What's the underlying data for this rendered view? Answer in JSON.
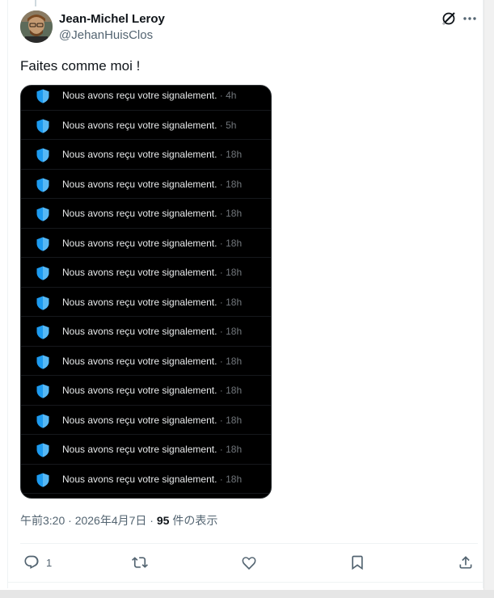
{
  "tweet": {
    "author": {
      "display_name": "Jean-Michel Leroy",
      "handle": "@JehanHuisClos"
    },
    "text": "Faites comme moi !",
    "icons": {
      "grok": "grok-icon",
      "more": "more-icon"
    },
    "media": {
      "notifications": [
        {
          "text": "Nous avons reçu votre signalement.",
          "time": " · 4h"
        },
        {
          "text": "Nous avons reçu votre signalement.",
          "time": " · 5h"
        },
        {
          "text": "Nous avons reçu votre signalement.",
          "time": " · 18h"
        },
        {
          "text": "Nous avons reçu votre signalement.",
          "time": " · 18h"
        },
        {
          "text": "Nous avons reçu votre signalement.",
          "time": " · 18h"
        },
        {
          "text": "Nous avons reçu votre signalement.",
          "time": " · 18h"
        },
        {
          "text": "Nous avons reçu votre signalement.",
          "time": " · 18h"
        },
        {
          "text": "Nous avons reçu votre signalement.",
          "time": " · 18h"
        },
        {
          "text": "Nous avons reçu votre signalement.",
          "time": " · 18h"
        },
        {
          "text": "Nous avons reçu votre signalement.",
          "time": " · 18h"
        },
        {
          "text": "Nous avons reçu votre signalement.",
          "time": " · 18h"
        },
        {
          "text": "Nous avons reçu votre signalement.",
          "time": " · 18h"
        },
        {
          "text": "Nous avons reçu votre signalement.",
          "time": " · 18h"
        },
        {
          "text": "Nous avons reçu votre signalement.",
          "time": " · 18h"
        }
      ],
      "shield_color": "#1d9bf0"
    },
    "meta": {
      "time": "午前3:20",
      "sep1": " · ",
      "date": "2026年4月7日",
      "sep2": " · ",
      "views_count": "95",
      "views_label": " 件の表示"
    },
    "actions": {
      "reply_count": "1",
      "reply_icon": "reply-icon",
      "retweet_icon": "retweet-icon",
      "like_icon": "like-icon",
      "bookmark_icon": "bookmark-icon",
      "share_icon": "share-icon"
    }
  },
  "colors": {
    "text_primary": "#0f1419",
    "text_secondary": "#536471",
    "media_bg": "#000000"
  }
}
